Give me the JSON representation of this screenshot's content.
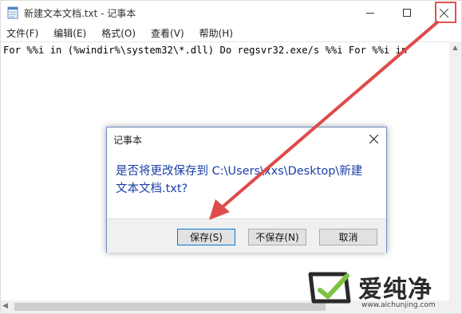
{
  "window": {
    "title": "新建文本文档.txt - 记事本",
    "icon": "notepad-icon"
  },
  "menu": [
    {
      "label": "文件(F)"
    },
    {
      "label": "编辑(E)"
    },
    {
      "label": "格式(O)"
    },
    {
      "label": "查看(V)"
    },
    {
      "label": "帮助(H)"
    }
  ],
  "editor": {
    "content": "For %%i in (%windir%\\system32\\*.dll) Do regsvr32.exe/s %%i For %%i in"
  },
  "dialog": {
    "title": "记事本",
    "message": "是否将更改保存到 C:\\Users\\xxs\\Desktop\\新建文本文档.txt?",
    "buttons": {
      "save": "保存(S)",
      "dont_save": "不保存(N)",
      "cancel": "取消"
    }
  },
  "annotation": {
    "arrow_color": "#e04a4a",
    "highlight_color": "#e0514f"
  },
  "watermark": {
    "brand": "爱纯净",
    "url": "www.aichunjing.com"
  }
}
